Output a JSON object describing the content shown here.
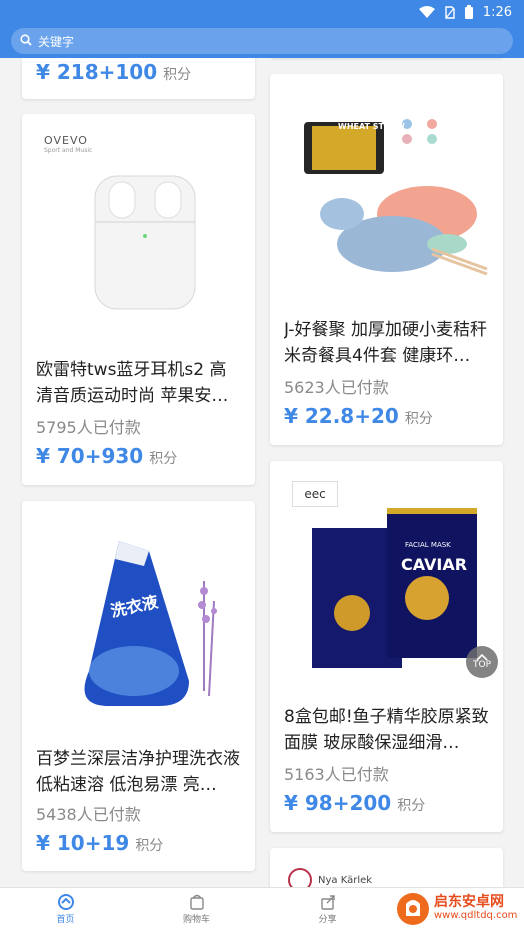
{
  "status_bar": {
    "time": "1:26"
  },
  "search": {
    "placeholder": "关键字"
  },
  "colors": {
    "accent": "#3f88e6",
    "muted": "#8a8a8a"
  },
  "products": [
    {
      "price": "¥ 218+100",
      "unit": "积分"
    },
    {
      "brand": "OVEVO",
      "brand_sub": "Sport and Music",
      "title": "欧雷特tws蓝牙耳机s2 高清音质运动时尚 苹果安…",
      "paid": "5795人已付款",
      "price": "¥ 70+930",
      "unit": "积分"
    },
    {
      "title": "百梦兰深层洁净护理洗衣液 低粘速溶 低泡易漂 亮…",
      "product_label": "洗衣液",
      "paid": "5438人已付款",
      "price": "¥ 10+19",
      "unit": "积分"
    },
    {
      "title": "J-好餐聚 加厚加硬小麦秸秆米奇餐具4件套 健康环…",
      "product_label": "WHEAT STRAW",
      "paid": "5623人已付款",
      "price": "¥ 22.8+20",
      "unit": "积分"
    },
    {
      "brand": "eec",
      "title": "8盒包邮!鱼子精华胶原紧致面膜 玻尿酸保湿细滑…",
      "product_label": "CAVIAR",
      "product_label2": "FACIAL MASK",
      "paid": "5163人已付款",
      "price": "¥ 98+200",
      "unit": "积分"
    },
    {
      "brand": "Nya Kärlek"
    }
  ],
  "top_button": {
    "label": "TOP"
  },
  "tabs": [
    {
      "label": "首页",
      "icon": "home-icon",
      "active": true
    },
    {
      "label": "购物车",
      "icon": "cart-icon",
      "active": false
    },
    {
      "label": "分享",
      "icon": "share-icon",
      "active": false
    }
  ],
  "watermark": {
    "line1": "启东安卓网",
    "line2": "www.qdltdq.com"
  }
}
